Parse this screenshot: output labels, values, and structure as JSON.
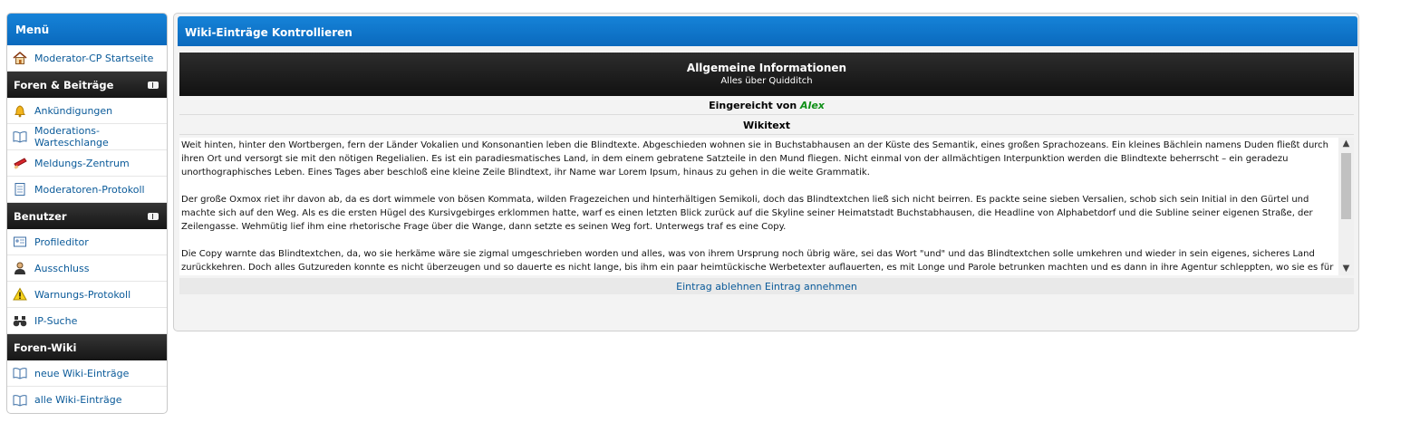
{
  "sidebar": {
    "title": "Menü",
    "items_top": [
      {
        "label": "Moderator-CP Startseite",
        "icon": "home-icon"
      }
    ],
    "sections": [
      {
        "title": "Foren & Beiträge",
        "items": [
          {
            "label": "Ankündigungen",
            "icon": "bell-icon"
          },
          {
            "label": "Moderations-Warteschlange",
            "icon": "book-icon"
          },
          {
            "label": "Meldungs-Zentrum",
            "icon": "flag-icon"
          },
          {
            "label": "Moderatoren-Protokoll",
            "icon": "notepad-icon"
          }
        ]
      },
      {
        "title": "Benutzer",
        "items": [
          {
            "label": "Profileditor",
            "icon": "profile-card-icon"
          },
          {
            "label": "Ausschluss",
            "icon": "user-icon"
          },
          {
            "label": "Warnungs-Protokoll",
            "icon": "warning-icon"
          },
          {
            "label": "IP-Suche",
            "icon": "binoculars-icon"
          }
        ]
      },
      {
        "title": "Foren-Wiki",
        "items": [
          {
            "label": "neue Wiki-Einträge",
            "icon": "book-icon"
          },
          {
            "label": "alle Wiki-Einträge",
            "icon": "book-icon"
          }
        ]
      }
    ]
  },
  "main": {
    "title": "Wiki-Einträge Kontrollieren",
    "info_title": "Allgemeine Informationen",
    "info_subtitle": "Alles über Quidditch",
    "submitted_prefix": "Eingereicht von",
    "author": "Alex",
    "wikitext_label": "Wikitext",
    "paragraphs": [
      "Weit hinten, hinter den Wortbergen, fern der Länder Vokalien und Konsonantien leben die Blindtexte. Abgeschieden wohnen sie in Buchstabhausen an der Küste des Semantik, eines großen Sprachozeans. Ein kleines Bächlein namens Duden fließt durch ihren Ort und versorgt sie mit den nötigen Regelialien. Es ist ein paradiesmatisches Land, in dem einem gebratene Satzteile in den Mund fliegen. Nicht einmal von der allmächtigen Interpunktion werden die Blindtexte beherrscht – ein geradezu unorthographisches Leben. Eines Tages aber beschloß eine kleine Zeile Blindtext, ihr Name war Lorem Ipsum, hinaus zu gehen in die weite Grammatik.",
      "Der große Oxmox riet ihr davon ab, da es dort wimmele von bösen Kommata, wilden Fragezeichen und hinterhältigen Semikoli, doch das Blindtextchen ließ sich nicht beirren. Es packte seine sieben Versalien, schob sich sein Initial in den Gürtel und machte sich auf den Weg. Als es die ersten Hügel des Kursivgebirges erklommen hatte, warf es einen letzten Blick zurück auf die Skyline seiner Heimatstadt Buchstabhausen, die Headline von Alphabetdorf und die Subline seiner eigenen Straße, der Zeilengasse. Wehmütig lief ihm eine rhetorische Frage über die Wange, dann setzte es seinen Weg fort. Unterwegs traf es eine Copy.",
      "Die Copy warnte das Blindtextchen, da, wo sie herkäme wäre sie zigmal umgeschrieben worden und alles, was von ihrem Ursprung noch übrig wäre, sei das Wort \"und\" und das Blindtextchen solle umkehren und wieder in sein eigenes, sicheres Land zurückkehren. Doch alles Gutzureden konnte es nicht überzeugen und so dauerte es nicht lange, bis ihm ein paar heimtückische Werbetexter auflauerten, es mit Longe und Parole betrunken machten und es dann in ihre Agentur schleppten, wo sie es für ihre Projekte wieder und wieder missbrauchten."
    ],
    "reject_label": "Eintrag ablehnen",
    "accept_label": "Eintrag annehmen"
  },
  "colors": {
    "header_blue": "#0a69bd",
    "category_dark": "#1e1e1e",
    "link": "#0a5a99",
    "author_green": "#0d8f16"
  }
}
